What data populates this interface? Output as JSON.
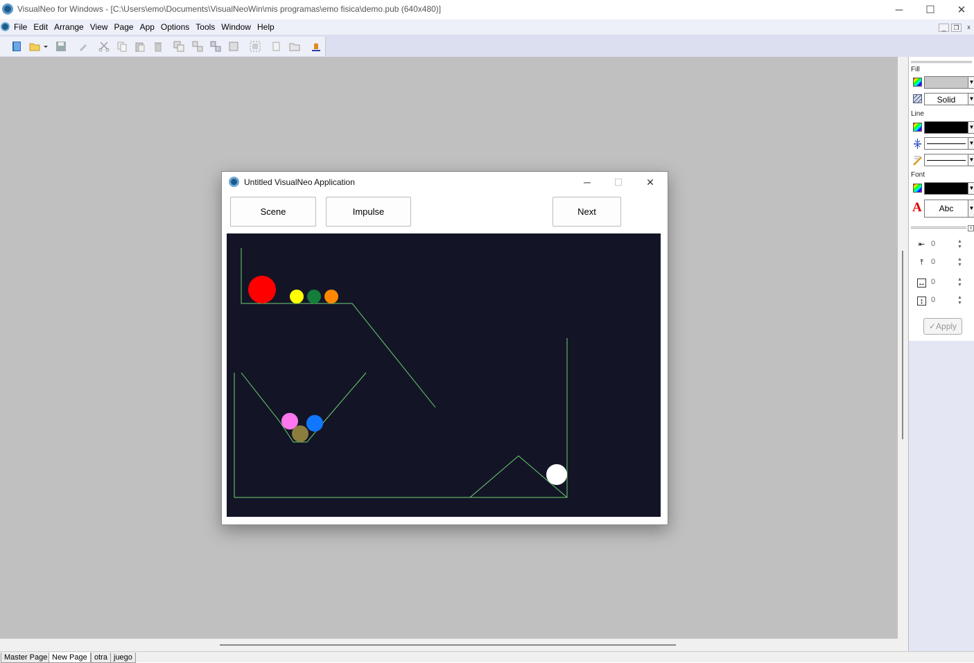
{
  "window": {
    "title": "VisualNeo for Windows - [C:\\Users\\emo\\Documents\\VisualNeoWin\\mis programas\\emo fisica\\demo.pub (640x480)]",
    "minimize": "─",
    "maximize": "☐",
    "close": "✕"
  },
  "menu": {
    "items": [
      "File",
      "Edit",
      "Arrange",
      "View",
      "Page",
      "App",
      "Options",
      "Tools",
      "Window",
      "Help"
    ]
  },
  "mdi": {
    "minimize": "_",
    "restore": "❐",
    "close": "x"
  },
  "toolbar": {
    "icons": [
      "new-book-icon",
      "open-folder-icon",
      "dropdown-arrow-icon",
      "save-icon",
      "paint-brush-icon",
      "cut-icon",
      "copy-icon",
      "paste-icon",
      "delete-icon",
      "bring-to-front-icon",
      "align-icon",
      "group-icon",
      "ungroup-icon",
      "select-all-icon",
      "duplicate-icon",
      "folder-icon",
      "run-icon"
    ]
  },
  "app_window": {
    "title": "Untitled VisualNeo Application",
    "minimize": "─",
    "maximize": "☐",
    "close": "✕",
    "buttons": {
      "scene": "Scene",
      "impulse": "Impulse",
      "next": "Next"
    }
  },
  "scene_colors": {
    "background": "#131527",
    "lines": "#6fd26f",
    "balls": [
      "#ff0000",
      "#ffff00",
      "#137d39",
      "#ff8800",
      "#ff77ee",
      "#1177ff",
      "#8a7d3e",
      "#ffffff"
    ]
  },
  "panel": {
    "fill_label": "Fill",
    "fill_pattern": "Solid",
    "line_label": "Line",
    "font_label": "Font",
    "font_sample": "Abc",
    "font_sample_glyph": "A",
    "position": {
      "x": "0",
      "y": "0",
      "width": "0",
      "height": "0"
    },
    "apply_label": "Apply",
    "apply_check": "✓",
    "colors": {
      "fill": "#c8c8c8",
      "line": "#000000",
      "font": "#000000",
      "font_glyph": "#dd0000"
    }
  },
  "tabs": [
    "Master Page",
    "New Page",
    "otra",
    "juego"
  ],
  "active_tab": "New Page"
}
